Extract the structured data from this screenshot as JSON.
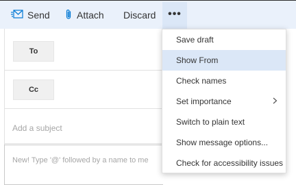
{
  "toolbar": {
    "send_label": "Send",
    "attach_label": "Attach",
    "discard_label": "Discard",
    "more_label": "•••"
  },
  "compose": {
    "to_label": "To",
    "cc_label": "Cc",
    "subject_placeholder": "Add a subject",
    "body_placeholder": "New! Type '@' followed by a name to me"
  },
  "menu": {
    "items": [
      {
        "label": "Save draft"
      },
      {
        "label": "Show From"
      },
      {
        "label": "Check names"
      },
      {
        "label": "Set importance"
      },
      {
        "label": "Switch to plain text"
      },
      {
        "label": "Show message options..."
      },
      {
        "label": "Check for accessibility issues"
      }
    ],
    "selected_index": 1,
    "submenu_index": 3
  },
  "colors": {
    "accent": "#0078d4",
    "toolbar_bg": "#eaf1fb",
    "selected_bg": "#dbe7f7"
  },
  "icons": {
    "send": "send-icon",
    "attach": "paperclip-icon",
    "chevron": "chevron-right-icon"
  }
}
